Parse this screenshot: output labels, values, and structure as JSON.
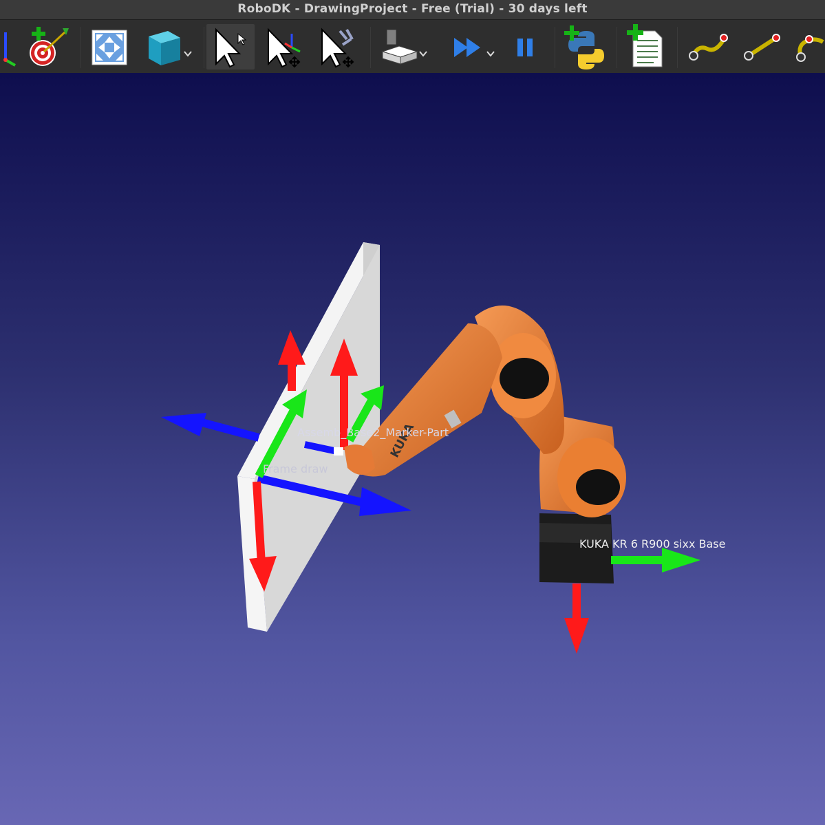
{
  "window": {
    "title": "RoboDK - DrawingProject - Free (Trial) - 30 days left"
  },
  "toolbar": {
    "buttons": [
      {
        "name": "reference-frame-icon"
      },
      {
        "name": "add-target-icon"
      },
      {
        "name": "fit-all-icon"
      },
      {
        "name": "view-cube-icon"
      },
      {
        "name": "select-pointer-icon"
      },
      {
        "name": "move-reference-icon"
      },
      {
        "name": "move-tool-icon"
      },
      {
        "name": "render-mode-icon"
      },
      {
        "name": "fast-simulation-icon"
      },
      {
        "name": "pause-simulation-icon"
      },
      {
        "name": "add-python-program-icon"
      },
      {
        "name": "add-program-icon"
      },
      {
        "name": "move-joint-icon"
      },
      {
        "name": "move-linear-icon"
      },
      {
        "name": "move-circular-icon"
      }
    ]
  },
  "scene": {
    "labels": {
      "part": "Assemb_Base2_Marker-Part",
      "frame": "Frame draw",
      "robot_base": "KUKA KR 6 R900 sixx Base",
      "robot_brand": "KUKA"
    },
    "colors": {
      "x_axis": "#ff1a1a",
      "y_axis": "#19e619",
      "z_axis": "#1414ff",
      "robot": "#e8782e",
      "base": "#1c1c1c",
      "panel": "#dedede"
    }
  }
}
